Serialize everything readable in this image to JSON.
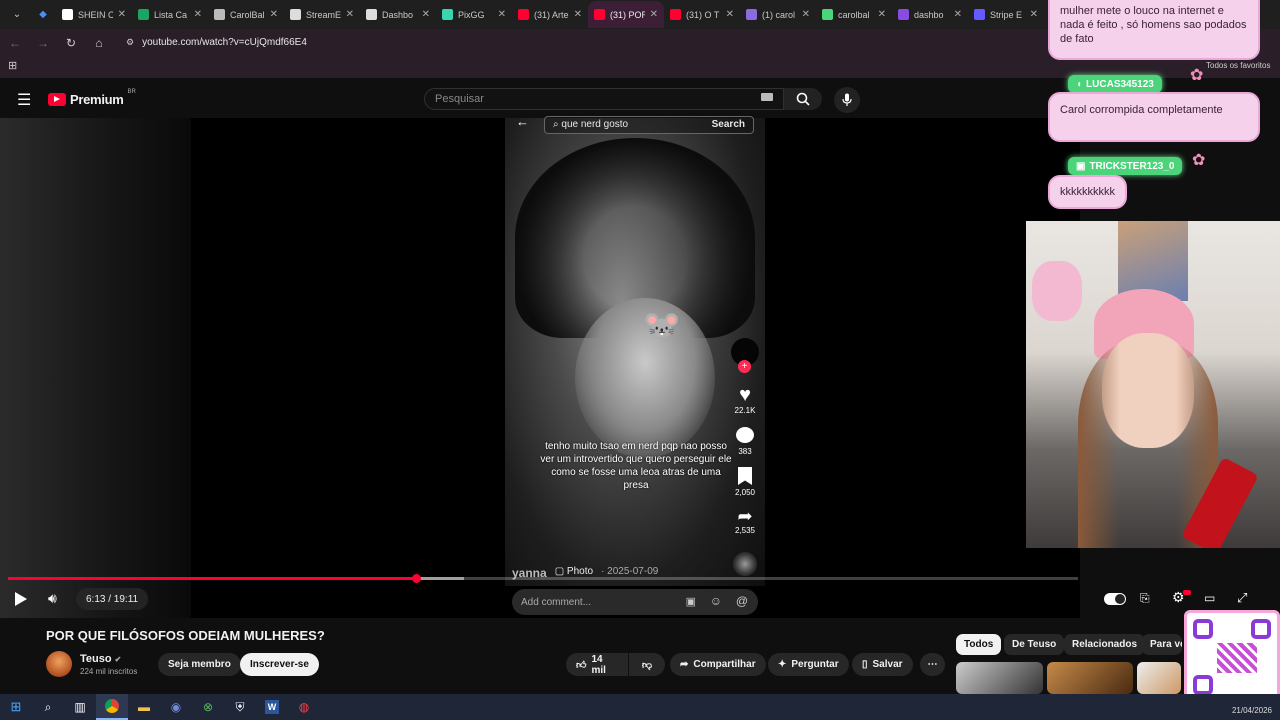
{
  "browser": {
    "tabs": [
      {
        "title": "SHEIN C",
        "color": "#ffffff"
      },
      {
        "title": "Lista Ca",
        "color": "#1ea362"
      },
      {
        "title": "CarolBal",
        "color": "#bbbbbb"
      },
      {
        "title": "StreamE",
        "color": "#dddddd"
      },
      {
        "title": "Dashbo",
        "color": "#dddddd"
      },
      {
        "title": "PixGG",
        "color": "#3ad5b0"
      },
      {
        "title": "(31) Arte",
        "color": "#ff0033"
      },
      {
        "title": "(31) POR",
        "color": "#ff0033"
      },
      {
        "title": "(31) O T",
        "color": "#ff0033"
      },
      {
        "title": "(1) carol",
        "color": "#8a6ce0"
      },
      {
        "title": "carolbal",
        "color": "#4bd47a"
      },
      {
        "title": "dashbo",
        "color": "#8a4ce0"
      },
      {
        "title": "Stripe E",
        "color": "#635bff"
      }
    ],
    "active_tab_index": 7,
    "url": "youtube.com/watch?v=cUjQmdf66E4",
    "favorites_label": "Todos os favoritos"
  },
  "youtube": {
    "logo_text": "Premium",
    "logo_superscript": "BR",
    "search_placeholder": "Pesquisar"
  },
  "tiktok": {
    "search_text": "que nerd gosto",
    "search_button": "Search",
    "likes": "22.1K",
    "comments": "383",
    "saves": "2,050",
    "shares": "2,535",
    "caption": "tenho muito tsao em nerd pqp  nao posso ver um introvertido que quero perseguir ele como se fosse uma leoa atras de uma presa",
    "username": "yanna",
    "post_type": "Photo",
    "date": "· 2025-07-09",
    "comment_placeholder": "Add comment..."
  },
  "player": {
    "time": "6:13 / 19:11",
    "progress_fraction": 0.381,
    "buffered_fraction": 0.426
  },
  "video": {
    "title": "POR QUE FILÓSOFOS ODEIAM MULHERES?",
    "channel": "Teuso",
    "subscribers": "224 mil inscritos",
    "member_label": "Seja membro",
    "subscribe_label": "Inscrever-se",
    "likes": "14 mil",
    "share_label": "Compartilhar",
    "ask_label": "Perguntar",
    "save_label": "Salvar"
  },
  "chips": [
    "Todos",
    "De Teuso",
    "Relacionados",
    "Para vo"
  ],
  "chat": {
    "message1": "mulher mete o louco na internet e nada é feito , só homens sao podados de fato",
    "user2": "LUCAS345123",
    "message2": "Carol corrompida completamente",
    "user3": "TRICKSTER123_0",
    "message3": "kkkkkkkkkk"
  },
  "taskbar": {
    "date": "21/04/2026"
  },
  "colors": {
    "accent": "#ff0033",
    "chat_bubble": "#f6d1ec",
    "chat_name": "#4bd47a"
  }
}
